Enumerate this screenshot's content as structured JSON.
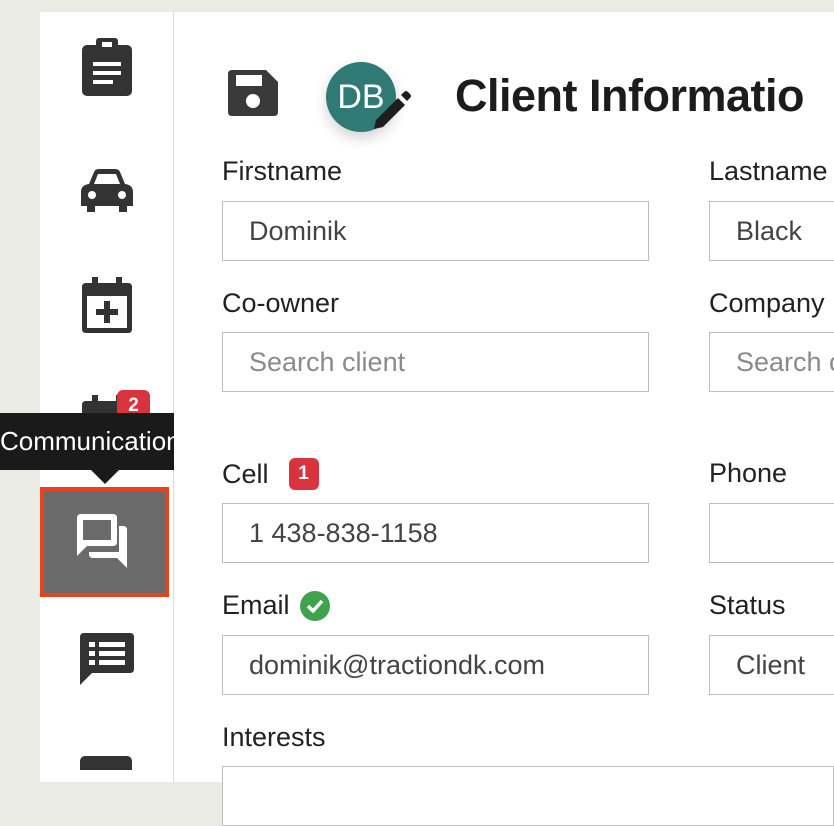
{
  "header": {
    "title": "Client Informatio",
    "avatar_initials": "DB",
    "save_icon": "save-icon",
    "edit_icon": "pencil-icon"
  },
  "sidebar": {
    "items": [
      {
        "icon": "clipboard-icon"
      },
      {
        "icon": "car-icon"
      },
      {
        "icon": "calendar-plus-icon"
      },
      {
        "icon": "calendar-grid-icon",
        "badge": "2"
      },
      {
        "icon": "chat-bubbles-icon",
        "active": true
      },
      {
        "icon": "comment-list-icon"
      },
      {
        "icon": "partial-icon"
      }
    ],
    "tooltip": "Communications"
  },
  "form": {
    "firstname_label": "Firstname",
    "firstname_value": "Dominik",
    "lastname_label": "Lastname",
    "lastname_value": "Black",
    "coowner_label": "Co-owner",
    "coowner_placeholder": "Search client",
    "company_label": "Company",
    "company_placeholder": "Search c",
    "cell_label": "Cell",
    "cell_badge": "1",
    "cell_value": "1 438-838-1158",
    "phone_label": "Phone",
    "phone_value": "",
    "email_label": "Email",
    "email_value": "dominik@tractiondk.com",
    "status_label": "Status",
    "status_value": "Client",
    "interests_label": "Interests"
  },
  "colors": {
    "accent_red": "#e8421f",
    "badge_red": "#d9343d",
    "avatar_teal": "#2f7a74",
    "verified_green": "#3fa34d"
  }
}
